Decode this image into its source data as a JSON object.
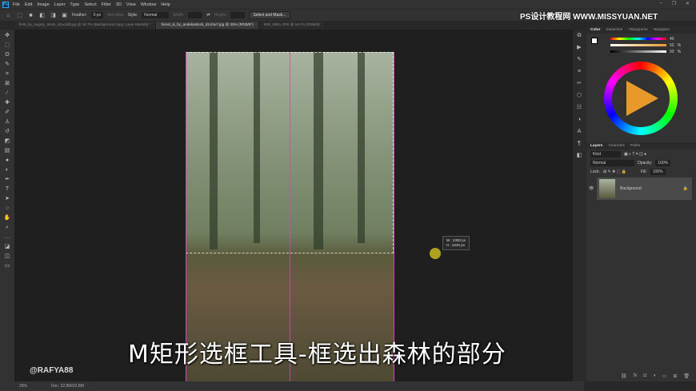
{
  "menu": {
    "items": [
      "File",
      "Edit",
      "Image",
      "Layer",
      "Type",
      "Select",
      "Filter",
      "3D",
      "View",
      "Window",
      "Help"
    ],
    "logo": "Ps"
  },
  "options": {
    "feather_label": "Feather:",
    "feather_value": "0 px",
    "antialias": "Anti-alias",
    "style_label": "Style:",
    "style_value": "Normal",
    "width_label": "Width:",
    "height_label": "Height:",
    "select_mask": "Select and Mask..."
  },
  "tabs": [
    "field_by_sugary_stock_d1xo3di.jpg @ 16.7% (Background copy, Layer Mask/8) *",
    "forest_iii_by_andekastock_d1cl4u7.jpg @ 25% (RGB/8*)",
    "IMG_9951.JPG @ 16.7% (RGB/8)"
  ],
  "brand": "PS设计教程网 WWW.MISSYUAN.NET",
  "canvas": {
    "info_w": "W :  2300 px",
    "info_h": "H :  2220 px",
    "subtitle": "M矩形选框工具-框选出森林的部分",
    "watermark": "@RAFYA88"
  },
  "status": {
    "zoom": "25%",
    "doc": "Doc: 22.8M/22.8M"
  },
  "color_panel": {
    "tabs": [
      "Color",
      "Swatches",
      "Histograms",
      "Navigator"
    ],
    "values": [
      "40",
      "52",
      "93"
    ],
    "units": [
      "%",
      "%",
      "%"
    ],
    "accent": "#e79a2a"
  },
  "layers_panel": {
    "tabs": [
      "Layers",
      "Channels",
      "Paths"
    ],
    "kind": "Kind",
    "blend": "Normal",
    "opacity_label": "Opacity:",
    "opacity": "100%",
    "lock_label": "Lock:",
    "fill_label": "Fill:",
    "fill": "100%",
    "layers": [
      {
        "name": "Background",
        "locked": true,
        "visible": true
      }
    ]
  }
}
